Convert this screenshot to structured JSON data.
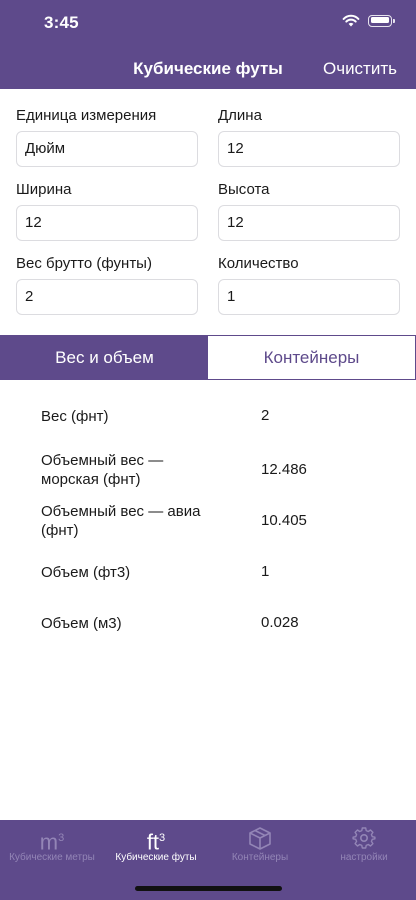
{
  "status_bar": {
    "time": "3:45"
  },
  "nav": {
    "title": "Кубические футы",
    "clear_label": "Очистить"
  },
  "form": {
    "unit": {
      "label": "Единица измерения",
      "value": "Дюйм"
    },
    "length": {
      "label": "Длина",
      "value": "12"
    },
    "width": {
      "label": "Ширина",
      "value": "12"
    },
    "height": {
      "label": "Высота",
      "value": "12"
    },
    "gross_weight": {
      "label": "Вес брутто (фунты)",
      "value": "2"
    },
    "quantity": {
      "label": "Количество",
      "value": "1"
    }
  },
  "segment": {
    "weight_volume": "Вес и объем",
    "containers": "Контейнеры",
    "selected": "weight_volume"
  },
  "results": [
    {
      "label": "Вес (фнт)",
      "value": "2"
    },
    {
      "label": "Объемный вес — морская (фнт)",
      "value": "12.486"
    },
    {
      "label": "Объемный вес — авиа (фнт)",
      "value": "10.405"
    },
    {
      "label": "Объем (фт3)",
      "value": "1"
    },
    {
      "label": "Объем (м3)",
      "value": "0.028"
    }
  ],
  "tabbar": {
    "tabs": [
      {
        "icon_text": "m",
        "icon_sup": "3",
        "label": "Кубические метры",
        "icon": "cubic-meters-icon"
      },
      {
        "icon_text": "ft",
        "icon_sup": "3",
        "label": "Кубические футы",
        "icon": "cubic-feet-icon",
        "active": true
      },
      {
        "label": "Контейнеры",
        "icon": "box-icon"
      },
      {
        "label": "настройки",
        "icon": "gear-icon"
      }
    ]
  },
  "colors": {
    "accent": "#5e4a8b",
    "tab_inactive": "#9385b6",
    "input_border": "#dcdce0"
  }
}
